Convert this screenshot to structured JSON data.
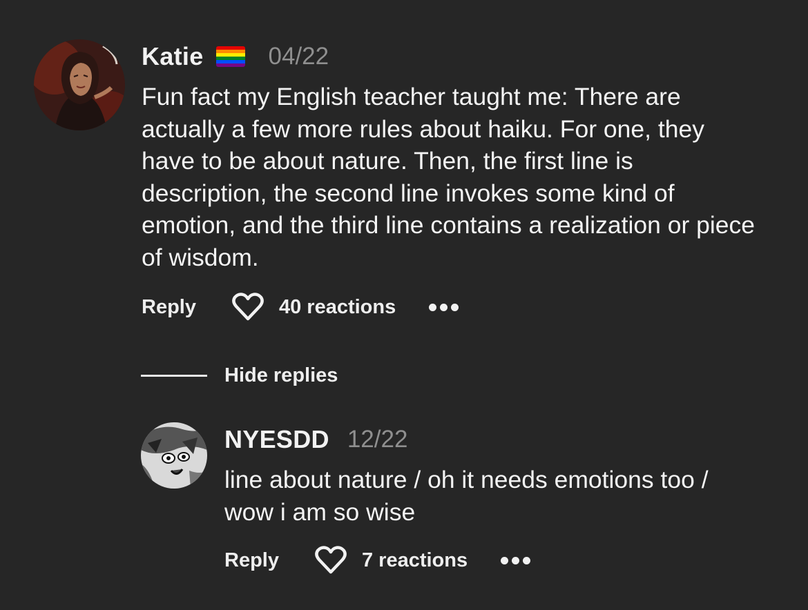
{
  "comment": {
    "username": "Katie",
    "flag_icon": "rainbow-flag-icon",
    "date": "04/22",
    "text": "Fun fact my English teacher taught me: There are actually a few more rules about haiku. For one, they have to be about nature. Then, the first line is description, the second line invokes some kind of emotion, and the third line contains a realization or piece of wisdom.",
    "reply_label": "Reply",
    "reactions_label": "40 reactions"
  },
  "hide_replies_label": "Hide replies",
  "reply": {
    "username": "NYESDD",
    "date": "12/22",
    "text": "line about nature / oh it needs emotions too / wow i am so wise",
    "reply_label": "Reply",
    "reactions_label": "7 reactions"
  },
  "colors": {
    "background": "#262626",
    "text": "#f4f4f4",
    "muted": "#8f8f8f"
  }
}
